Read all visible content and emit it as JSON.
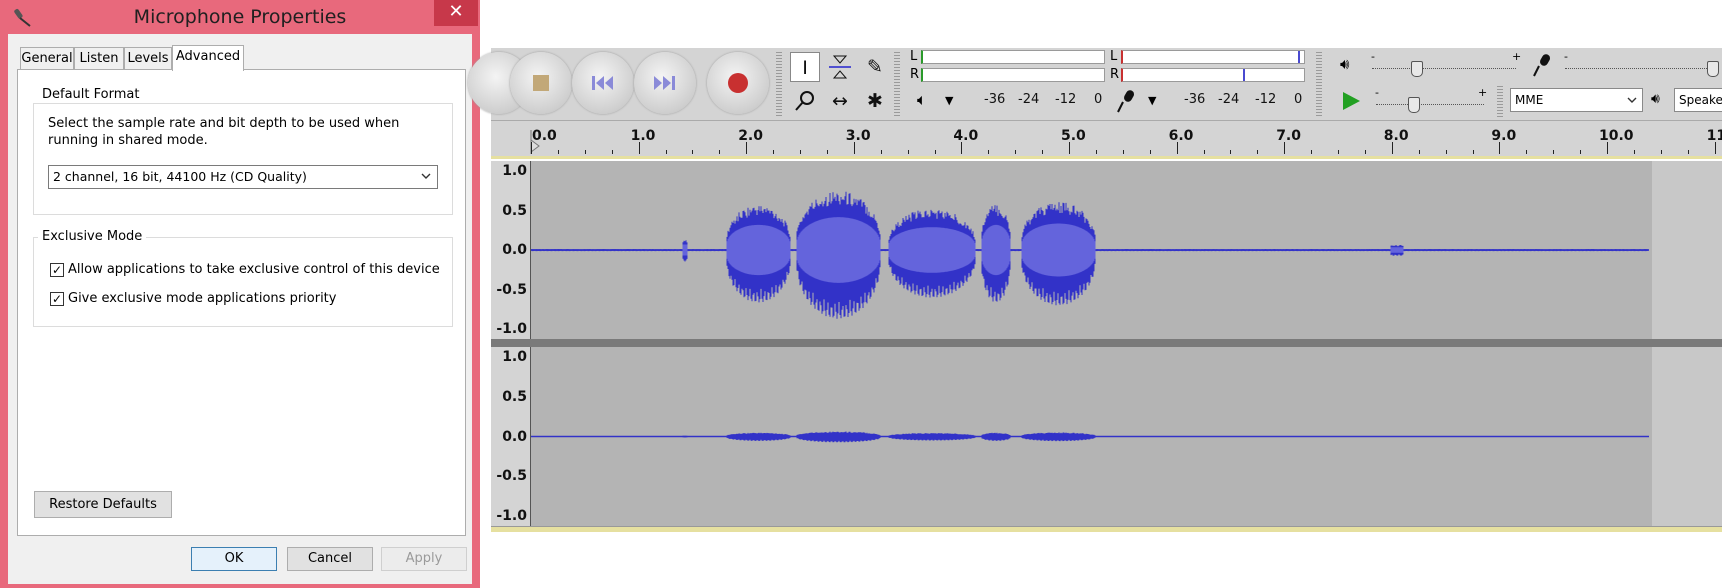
{
  "dialog": {
    "title": "Microphone Properties",
    "close_glyph": "✕",
    "tabs": [
      "General",
      "Listen",
      "Levels",
      "Advanced"
    ],
    "active_tab": "Advanced",
    "default_format": {
      "legend": "Default Format",
      "description": "Select the sample rate and bit depth to be used when running in shared mode.",
      "selected_value": "2 channel, 16 bit, 44100 Hz (CD Quality)"
    },
    "exclusive_mode": {
      "legend": "Exclusive Mode",
      "options": [
        {
          "label": "Allow applications to take exclusive control of this device",
          "checked": true
        },
        {
          "label": "Give exclusive mode applications priority",
          "checked": true
        }
      ]
    },
    "restore_defaults_label": "Restore Defaults",
    "ok_label": "OK",
    "cancel_label": "Cancel",
    "apply_label": "Apply",
    "check_glyph": "✓"
  },
  "audacity": {
    "meters": {
      "playback": {
        "left_label": "L",
        "right_label": "R"
      },
      "record": {
        "left_label": "L",
        "right_label": "R"
      },
      "scale_ticks": [
        "-36",
        "-24",
        "-12",
        "0"
      ]
    },
    "mixer": {
      "minus": "-",
      "plus": "+"
    },
    "host_label": "MME",
    "output_device_label": "Speake",
    "timeline_labels": [
      "0.0",
      "1.0",
      "2.0",
      "3.0",
      "4.0",
      "5.0",
      "6.0",
      "7.0",
      "8.0",
      "9.0",
      "10.0",
      "11."
    ],
    "amplitude_labels": [
      "1.0",
      "0.5",
      "0.0",
      "-0.5",
      "-1.0"
    ],
    "colors": {
      "waveform": "#3232c8",
      "waveform_rms": "#6464dc",
      "track_bg": "#b4b4b4",
      "play_green": "#22a022",
      "record_red": "#c83030"
    }
  }
}
